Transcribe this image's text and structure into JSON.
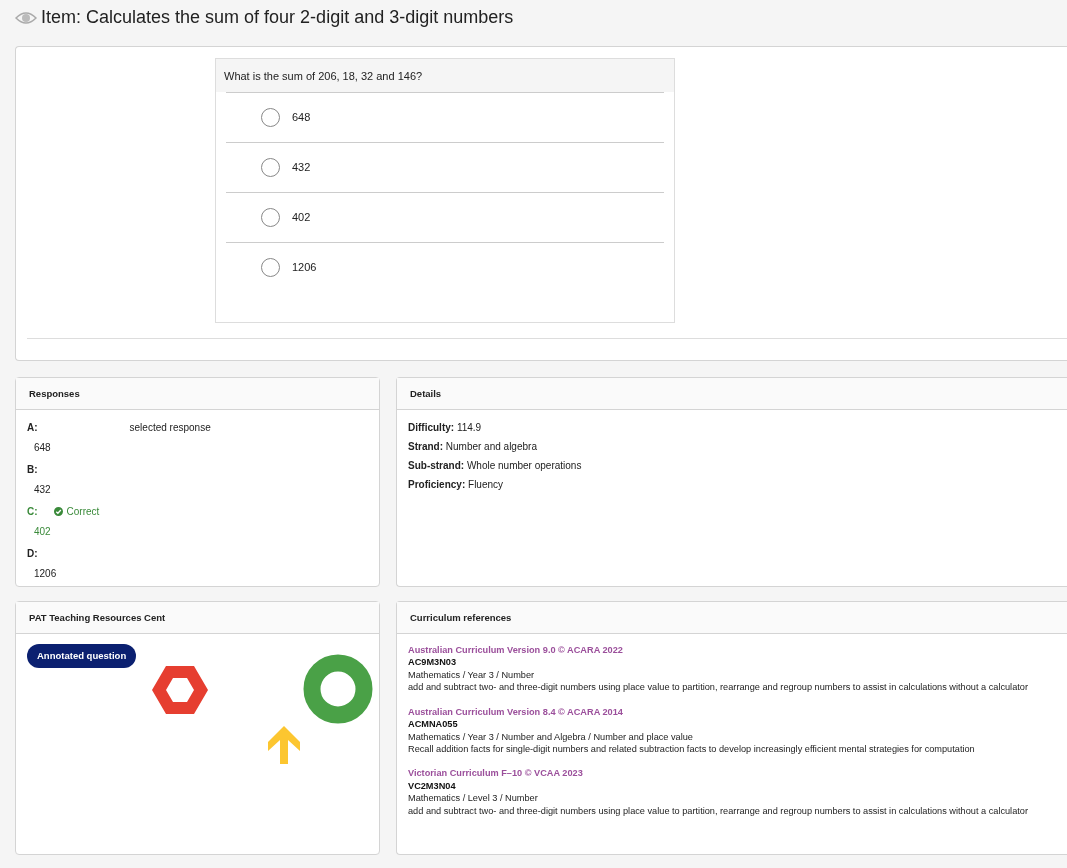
{
  "page_title": "Item: Calculates the sum of four 2-digit and 3-digit numbers",
  "question": {
    "prompt": "What is the sum of 206, 18, 32 and 146?",
    "options": [
      {
        "label": "648",
        "selected": false
      },
      {
        "label": "432",
        "selected": false
      },
      {
        "label": "402",
        "selected": false
      },
      {
        "label": "1206",
        "selected": false
      }
    ]
  },
  "responses": {
    "title": "Responses",
    "items": [
      {
        "letter": "A:",
        "answer": "648",
        "correct": false,
        "note": "selected response"
      },
      {
        "letter": "B:",
        "answer": "432",
        "correct": false
      },
      {
        "letter": "C:",
        "answer": "402",
        "correct": true,
        "note": "Correct"
      },
      {
        "letter": "D:",
        "answer": "1206",
        "correct": false
      }
    ]
  },
  "details": {
    "title": "Details",
    "items": [
      {
        "label": "Difficulty:",
        "value": "114.9"
      },
      {
        "label": "Strand:",
        "value": "Number and algebra"
      },
      {
        "label": "Sub-strand:",
        "value": "Whole number operations"
      },
      {
        "label": "Proficiency:",
        "value": "Fluency"
      }
    ]
  },
  "resources": {
    "title": "PAT Teaching Resources Cent",
    "badge": "Annotated question"
  },
  "curriculum": {
    "title": "Curriculum references",
    "items": [
      {
        "source": "Australian Curriculum Version 9.0 © ACARA 2022",
        "code": "AC9M3N03",
        "path": "Mathematics / Year 3 / Number",
        "description": "add and subtract two- and three-digit numbers using place value to partition, rearrange and regroup numbers to assist in calculations without a calculator"
      },
      {
        "source": "Australian Curriculum Version 8.4 © ACARA 2014",
        "code": "ACMNA055",
        "path": "Mathematics / Year 3 / Number and Algebra / Number and place value",
        "description": "Recall addition facts for single-digit numbers and related subtraction facts to develop increasingly efficient mental strategies for computation"
      },
      {
        "source": "Victorian Curriculum F–10 © VCAA 2023",
        "code": "VC2M3N04",
        "path": "Mathematics / Level 3 / Number",
        "description": "add and subtract two- and three-digit numbers using place value to partition, rearrange and regroup numbers to assist in calculations without a calculator"
      }
    ]
  }
}
